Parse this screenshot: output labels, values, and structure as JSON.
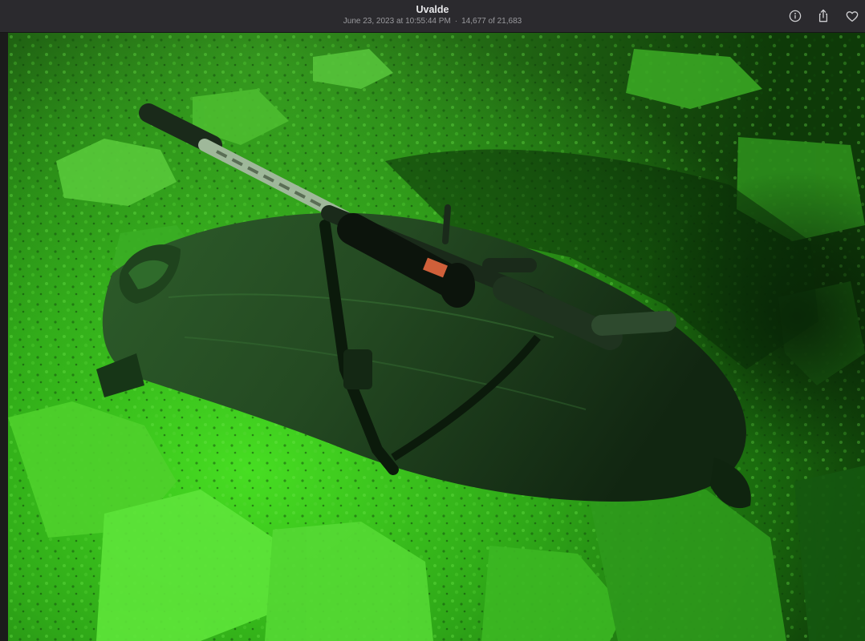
{
  "window": {
    "title": "Uvalde",
    "date": "June 23, 2023 at 10:55:44 PM",
    "separator": "·",
    "position": "14,677 of 21,683"
  },
  "toolbar": {
    "info_icon": "info-circle-icon",
    "share_icon": "share-icon",
    "favorite_icon": "heart-icon"
  },
  "colors": {
    "titlebar": "#2b2a2e",
    "ground_bright": "#3fd021",
    "ground_dark": "#0f3d08",
    "animal": "#1c3a1c"
  }
}
